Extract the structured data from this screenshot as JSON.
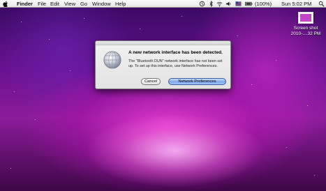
{
  "menubar": {
    "app_name": "Finder",
    "menus": [
      "File",
      "Edit",
      "View",
      "Go",
      "Window",
      "Help"
    ],
    "battery": "(100%)",
    "clock": "Sun 5:02 PM",
    "status_icons": [
      "time-machine-icon",
      "bluetooth-icon",
      "wifi-icon",
      "volume-icon",
      "flag-icon",
      "battery-icon",
      "search-icon"
    ]
  },
  "desktop": {
    "file": {
      "name_line1": "Screen shot",
      "name_line2": "2010-....32 PM"
    }
  },
  "dialog": {
    "title": "A new network interface has been detected.",
    "message": "The \"Bluetooth DUN\" network interface has not been set up. To set up this interface, use Network Preferences.",
    "cancel_label": "Cancel",
    "primary_label": "Network Preferences"
  },
  "colors": {
    "accent": "#7fa9ea",
    "wallpaper": "#8b1c9a"
  }
}
